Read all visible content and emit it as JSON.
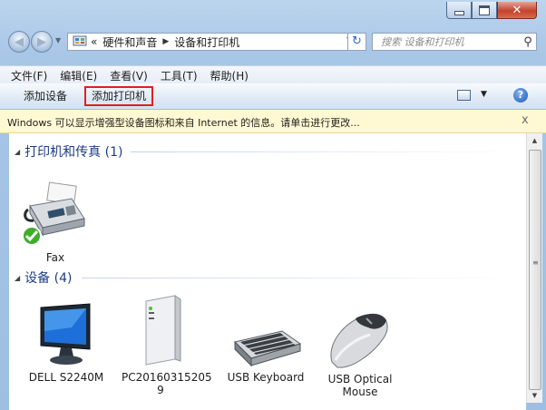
{
  "window": {
    "colors": {
      "frame": "#a8c6e6",
      "group_text": "#1e3c88",
      "highlight_box": "#e0201e",
      "infobar": "#fff9d3"
    }
  },
  "nav": {
    "recent_icon": "small-dropdown-arrow-icon",
    "breadcrumb_prefix": "«",
    "breadcrumb": [
      "硬件和声音",
      "设备和打印机"
    ],
    "refresh_icon": "refresh-icon",
    "search_placeholder": "搜索 设备和打印机",
    "search_icon": "magnifier-icon"
  },
  "menu": [
    "文件(F)",
    "编辑(E)",
    "查看(V)",
    "工具(T)",
    "帮助(H)"
  ],
  "toolbar": {
    "add_device": "添加设备",
    "add_printer": "添加打印机",
    "help": "?"
  },
  "infobar": {
    "message": "Windows 可以显示增强型设备图标和来自 Internet 的信息。请单击进行更改...",
    "close": "x"
  },
  "groups": [
    {
      "title": "打印机和传真 (1)",
      "items": [
        {
          "label": "Fax",
          "icon": "fax-printer-icon",
          "status_icon": "default-check-icon"
        }
      ]
    },
    {
      "title": "设备 (4)",
      "items": [
        {
          "label": "DELL S2240M",
          "icon": "monitor-icon"
        },
        {
          "label": "PC20160315205\n9",
          "label_line1": "PC20160315205",
          "label_line2": "9",
          "icon": "computer-tower-icon"
        },
        {
          "label": "USB Keyboard",
          "icon": "keyboard-icon"
        },
        {
          "label_line1": "USB Optical",
          "label_line2": "Mouse",
          "icon": "mouse-icon"
        }
      ]
    }
  ]
}
